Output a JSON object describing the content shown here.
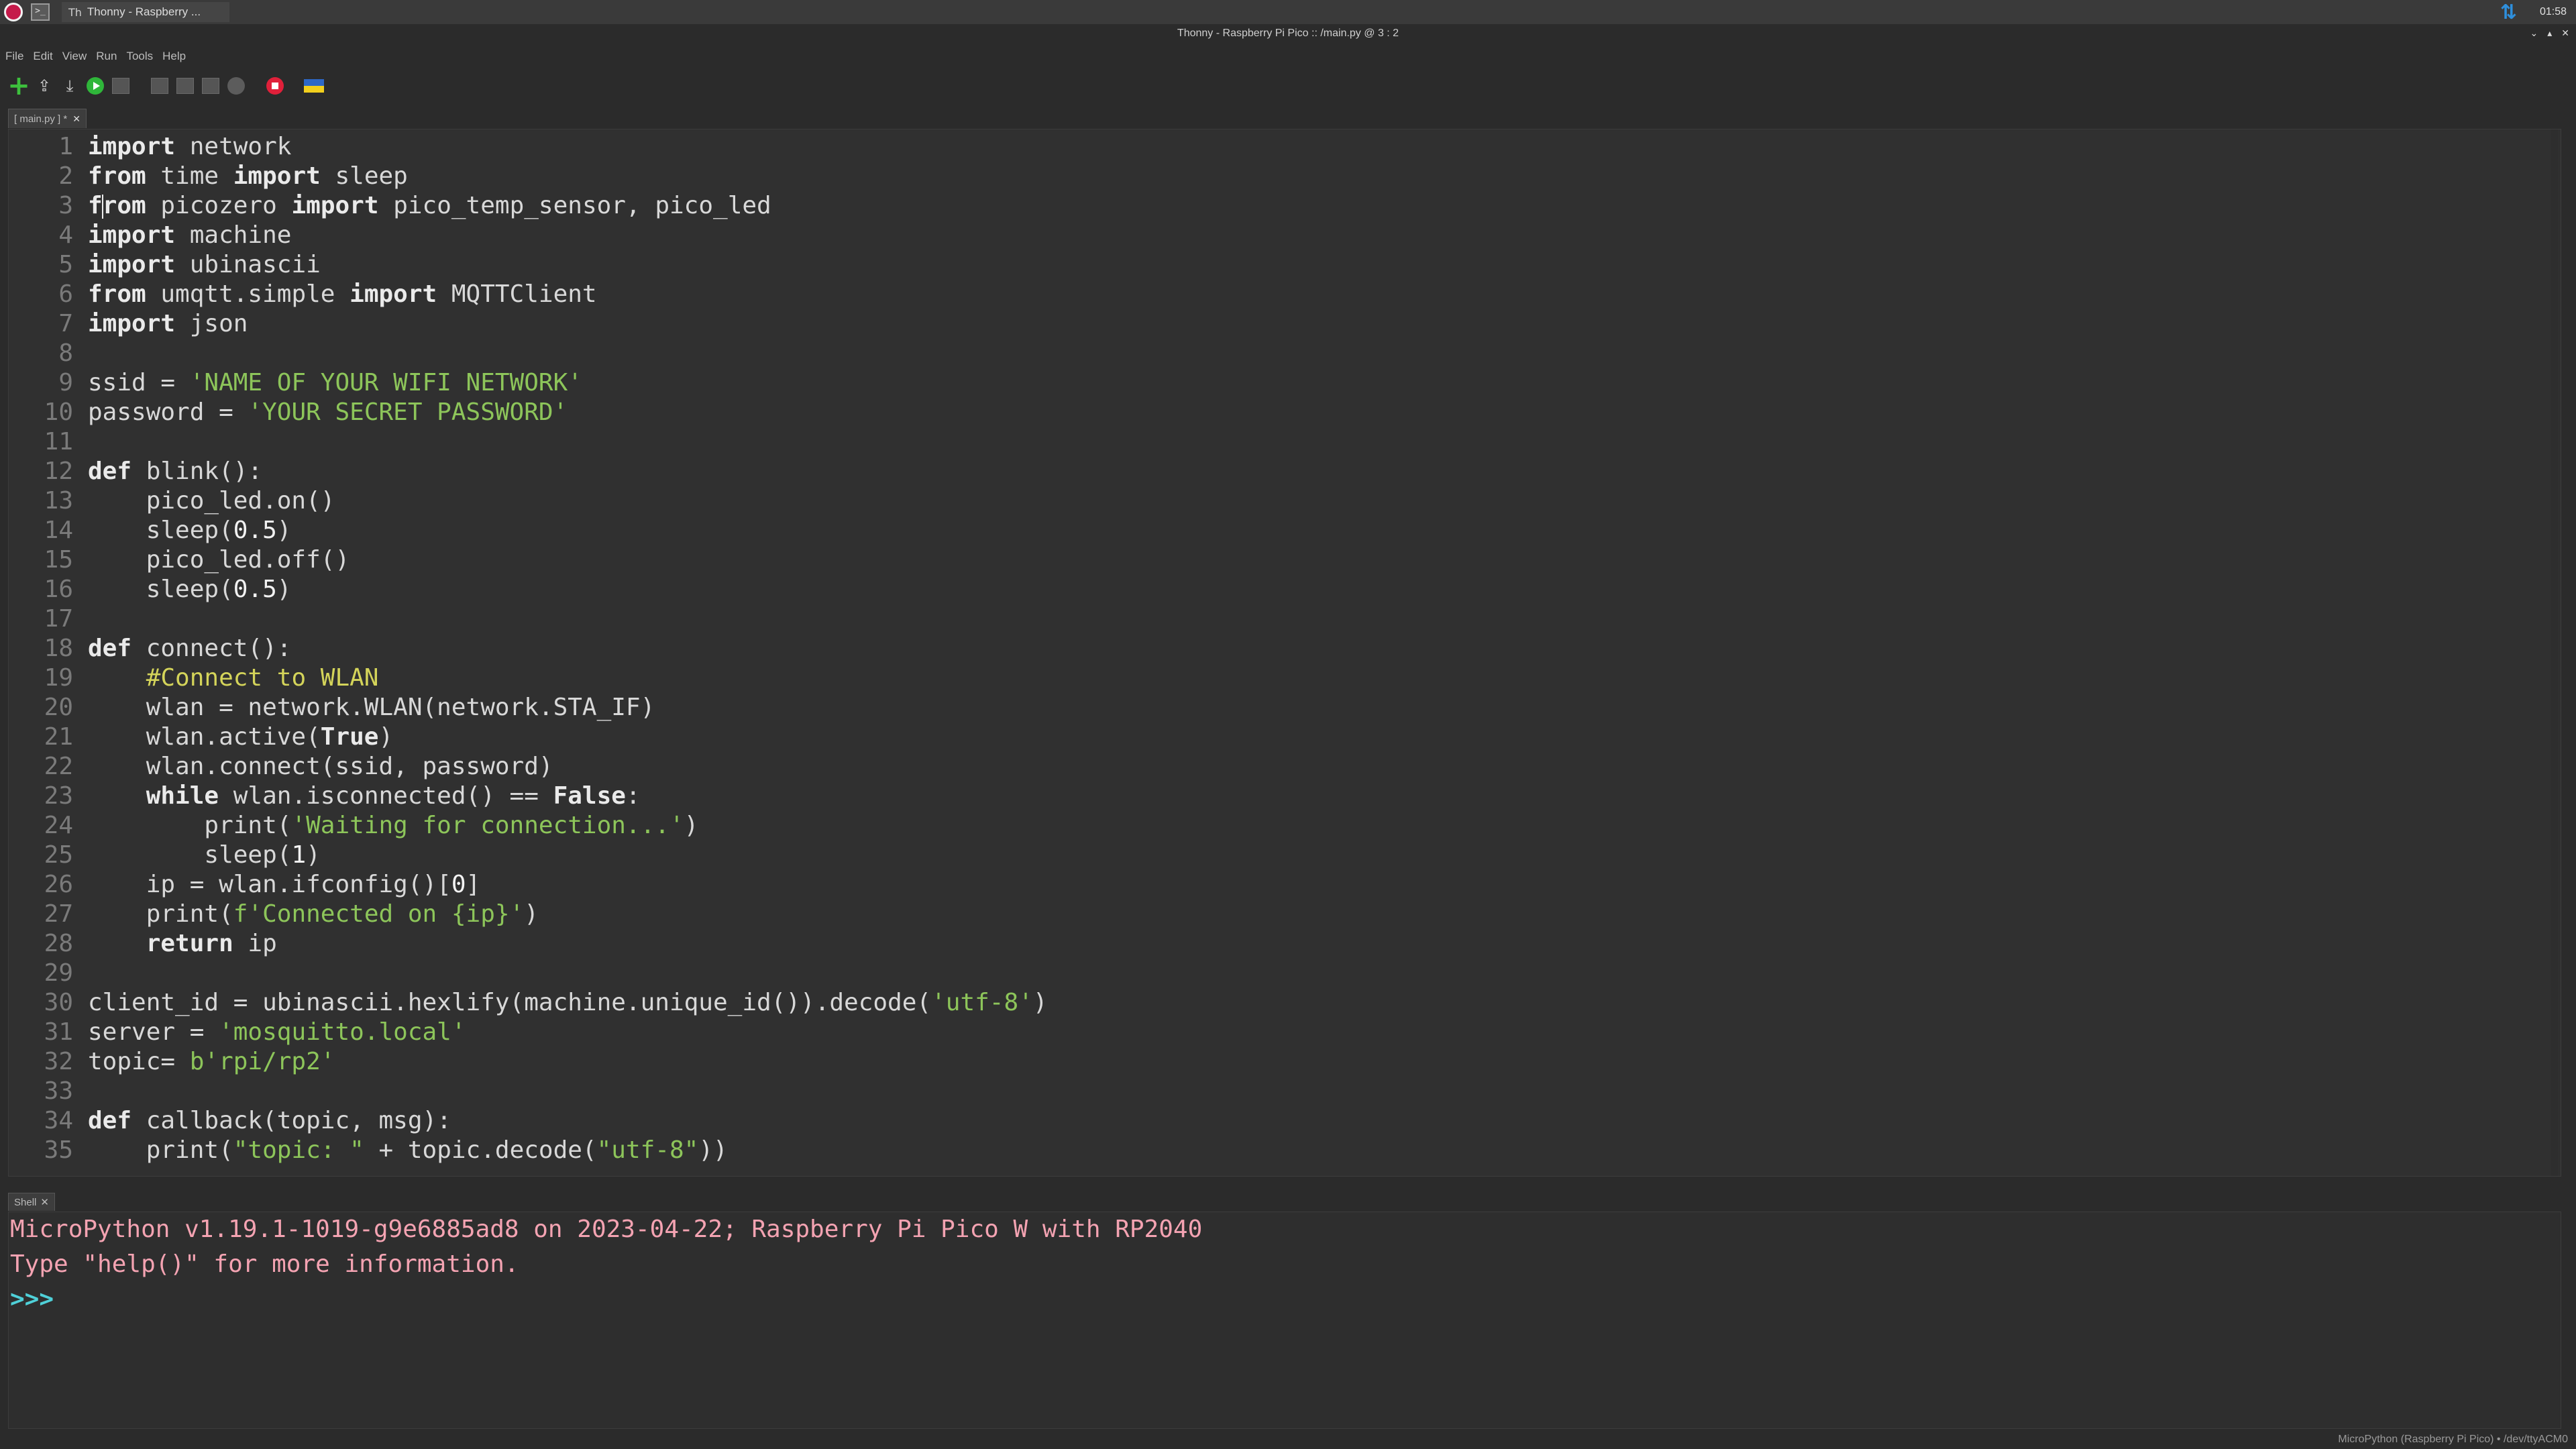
{
  "taskbar": {
    "task_label": "Thonny - Raspberry ...",
    "terminal_glyph": ">_",
    "clock": "01:58"
  },
  "window": {
    "title": "Thonny - Raspberry Pi Pico :: /main.py @ 3 : 2",
    "controls": [
      "⌄",
      "▴",
      "✕"
    ]
  },
  "menu": [
    "File",
    "Edit",
    "View",
    "Run",
    "Tools",
    "Help"
  ],
  "toolbar": {
    "icons": [
      "new-file-icon",
      "open-file-icon",
      "save-file-icon",
      "run-icon",
      "debug-icon",
      "step-over-icon",
      "step-into-icon",
      "step-out-icon",
      "resume-icon",
      "stop-icon",
      "support-ukraine-icon"
    ]
  },
  "editor": {
    "tab_label": "[ main.py ] *",
    "tab_close": "✕",
    "cursor": {
      "line": 3,
      "col": 2
    },
    "lines": [
      [
        {
          "t": "import",
          "c": "kw"
        },
        {
          "t": " network"
        }
      ],
      [
        {
          "t": "from",
          "c": "kw"
        },
        {
          "t": " time "
        },
        {
          "t": "import",
          "c": "kw"
        },
        {
          "t": " sleep"
        }
      ],
      [
        {
          "t": "f",
          "c": "kw"
        },
        {
          "t": "|",
          "c": "caret"
        },
        {
          "t": "rom",
          "c": "kw"
        },
        {
          "t": " picozero "
        },
        {
          "t": "import",
          "c": "kw"
        },
        {
          "t": " pico_temp_sensor, pico_led"
        }
      ],
      [
        {
          "t": "import",
          "c": "kw"
        },
        {
          "t": " machine"
        }
      ],
      [
        {
          "t": "import",
          "c": "kw"
        },
        {
          "t": " ubinascii"
        }
      ],
      [
        {
          "t": "from",
          "c": "kw"
        },
        {
          "t": " umqtt.simple "
        },
        {
          "t": "import",
          "c": "kw"
        },
        {
          "t": " MQTTClient"
        }
      ],
      [
        {
          "t": "import",
          "c": "kw"
        },
        {
          "t": " json"
        }
      ],
      [],
      [
        {
          "t": "ssid = "
        },
        {
          "t": "'NAME OF YOUR WIFI NETWORK'",
          "c": "st"
        }
      ],
      [
        {
          "t": "password = "
        },
        {
          "t": "'YOUR SECRET PASSWORD'",
          "c": "st"
        }
      ],
      [],
      [
        {
          "t": "def",
          "c": "kw"
        },
        {
          "t": " blink():"
        }
      ],
      [
        {
          "t": "    pico_led.on()"
        }
      ],
      [
        {
          "t": "    sleep("
        },
        {
          "t": "0.5",
          "c": "nu"
        },
        {
          "t": ")"
        }
      ],
      [
        {
          "t": "    pico_led.off()"
        }
      ],
      [
        {
          "t": "    sleep("
        },
        {
          "t": "0.5",
          "c": "nu"
        },
        {
          "t": ")"
        }
      ],
      [],
      [
        {
          "t": "def",
          "c": "kw"
        },
        {
          "t": " connect():"
        }
      ],
      [
        {
          "t": "    "
        },
        {
          "t": "#Connect to WLAN",
          "c": "cm"
        }
      ],
      [
        {
          "t": "    wlan = network.WLAN(network.STA_IF)"
        }
      ],
      [
        {
          "t": "    wlan.active("
        },
        {
          "t": "True",
          "c": "kw"
        },
        {
          "t": ")"
        }
      ],
      [
        {
          "t": "    wlan.connect(ssid, password)"
        }
      ],
      [
        {
          "t": "    "
        },
        {
          "t": "while",
          "c": "kw"
        },
        {
          "t": " wlan.isconnected() == "
        },
        {
          "t": "False",
          "c": "kw"
        },
        {
          "t": ":"
        }
      ],
      [
        {
          "t": "        print("
        },
        {
          "t": "'Waiting for connection...'",
          "c": "st"
        },
        {
          "t": ")"
        }
      ],
      [
        {
          "t": "        sleep("
        },
        {
          "t": "1",
          "c": "nu"
        },
        {
          "t": ")"
        }
      ],
      [
        {
          "t": "    ip = wlan.ifconfig()["
        },
        {
          "t": "0",
          "c": "nu"
        },
        {
          "t": "]"
        }
      ],
      [
        {
          "t": "    print("
        },
        {
          "t": "f'Connected on {ip}'",
          "c": "st"
        },
        {
          "t": ")"
        }
      ],
      [
        {
          "t": "    "
        },
        {
          "t": "return",
          "c": "kw"
        },
        {
          "t": " ip"
        }
      ],
      [],
      [
        {
          "t": "client_id = ubinascii.hexlify(machine.unique_id()).decode("
        },
        {
          "t": "'utf-8'",
          "c": "st"
        },
        {
          "t": ")"
        }
      ],
      [
        {
          "t": "server = "
        },
        {
          "t": "'mosquitto.local'",
          "c": "st"
        }
      ],
      [
        {
          "t": "topic= "
        },
        {
          "t": "b'rpi/rp2'",
          "c": "st"
        }
      ],
      [],
      [
        {
          "t": "def",
          "c": "kw"
        },
        {
          "t": " callback(topic, msg):"
        }
      ],
      [
        {
          "t": "    print("
        },
        {
          "t": "\"topic: \"",
          "c": "st"
        },
        {
          "t": " + topic.decode("
        },
        {
          "t": "\"utf-8\"",
          "c": "st"
        },
        {
          "t": "))"
        }
      ]
    ]
  },
  "shell": {
    "tab_label": "Shell",
    "tab_close": "✕",
    "banner_1": "MicroPython v1.19.1-1019-g9e6885ad8 on 2023-04-22; Raspberry Pi Pico W with RP2040",
    "banner_2": "Type \"help()\" for more information.",
    "prompt": ">>>"
  },
  "status": {
    "interpreter": "MicroPython (Raspberry Pi Pico)  •  /dev/ttyACM0"
  },
  "colors": {
    "keyword": "#eaeaea",
    "string": "#8dc55a",
    "comment": "#d4d45a",
    "shell_text": "#f4a3b2",
    "prompt": "#4fd0d8"
  }
}
